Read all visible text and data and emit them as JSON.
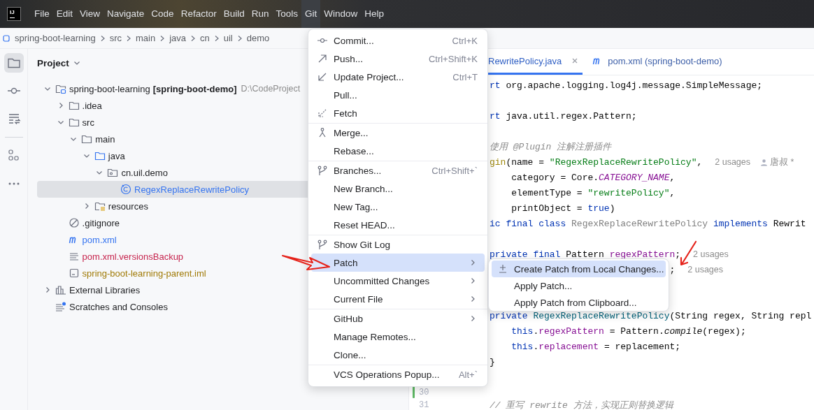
{
  "menubar": {
    "logo": "IJ",
    "items": [
      {
        "label": "File",
        "selected": false
      },
      {
        "label": "Edit",
        "selected": false
      },
      {
        "label": "View",
        "selected": false
      },
      {
        "label": "Navigate",
        "selected": false
      },
      {
        "label": "Code",
        "selected": false
      },
      {
        "label": "Refactor",
        "selected": false
      },
      {
        "label": "Build",
        "selected": false
      },
      {
        "label": "Run",
        "selected": false
      },
      {
        "label": "Tools",
        "selected": false
      },
      {
        "label": "Git",
        "selected": true
      },
      {
        "label": "Window",
        "selected": false
      },
      {
        "label": "Help",
        "selected": false
      }
    ]
  },
  "breadcrumb": [
    "spring-boot-learning",
    "src",
    "main",
    "java",
    "cn",
    "uil",
    "demo"
  ],
  "tool_strip": [
    {
      "kind": "project",
      "selected": true
    },
    {
      "kind": "commit",
      "selected": false
    },
    {
      "kind": "structure",
      "selected": false
    },
    {
      "kind": "plugins",
      "selected": false
    },
    {
      "kind": "more",
      "selected": false
    }
  ],
  "project": {
    "title": "Project",
    "tree": [
      {
        "label": "spring-boot-learning",
        "module": "[spring-boot-demo]",
        "path": "D:\\CodeProject",
        "kind": "module",
        "expanded": true,
        "selected": false,
        "children": [
          {
            "label": ".idea",
            "kind": "folder",
            "expanded": false,
            "selected": false
          },
          {
            "label": "src",
            "kind": "folder",
            "expanded": true,
            "selected": false,
            "children": [
              {
                "label": "main",
                "kind": "folder",
                "expanded": true,
                "selected": false,
                "children": [
                  {
                    "label": "java",
                    "kind": "source",
                    "expanded": true,
                    "selected": false,
                    "children": [
                      {
                        "label": "cn.uil.demo",
                        "kind": "package",
                        "expanded": true,
                        "selected": false,
                        "children": [
                          {
                            "label": "RegexReplaceRewritePolicy",
                            "kind": "class",
                            "selected": true,
                            "color": "#3574f0"
                          }
                        ]
                      }
                    ]
                  },
                  {
                    "label": "resources",
                    "kind": "resources",
                    "expanded": false,
                    "selected": false
                  }
                ]
              }
            ]
          },
          {
            "label": ".gitignore",
            "kind": "ignore",
            "selected": false
          },
          {
            "label": "pom.xml",
            "kind": "maven",
            "selected": false,
            "color": "#3574f0"
          },
          {
            "label": "pom.xml.versionsBackup",
            "kind": "text",
            "selected": false,
            "color": "#c7254e"
          },
          {
            "label": "spring-boot-learning-parent.iml",
            "kind": "iml",
            "selected": false,
            "color": "#a07a06"
          }
        ]
      },
      {
        "label": "External Libraries",
        "kind": "libraries",
        "expanded": false,
        "selected": false
      },
      {
        "label": "Scratches and Consoles",
        "kind": "scratches",
        "selected": false
      }
    ]
  },
  "editor": {
    "tabs": [
      {
        "label": "RewritePolicy.java",
        "kind": "cut",
        "selected": true
      },
      {
        "label": "pom.xml (spring-boot-demo)",
        "kind": "maven",
        "selected": false
      }
    ],
    "lines": [
      {
        "changed": false,
        "tokens": [
          {
            "kind": "keyword",
            "text": "rt"
          },
          {
            "kind": "plain",
            "text": " org.apache.logging.log4j.message.SimpleMessage;"
          }
        ]
      },
      {
        "changed": false
      },
      {
        "changed": false,
        "tokens": [
          {
            "kind": "keyword",
            "text": "rt"
          },
          {
            "kind": "plain",
            "text": " java.util.regex.Pattern;"
          }
        ]
      },
      {
        "changed": false
      },
      {
        "changed": false,
        "tokens": [
          {
            "kind": "comment",
            "text": "使用 @Plugin 注解注册插件"
          }
        ]
      },
      {
        "changed": false,
        "tokens": [
          {
            "kind": "annotation",
            "text": "gin"
          },
          {
            "kind": "plain",
            "text": "(name = "
          },
          {
            "kind": "string",
            "text": "\"RegexReplaceRewritePolicy\""
          },
          {
            "kind": "plain",
            "text": ","
          }
        ],
        "usages": "2 usages",
        "author": "唐叔 *"
      },
      {
        "changed": false,
        "tokens": [
          {
            "kind": "plain",
            "text": "    category = Core."
          },
          {
            "kind": "constant",
            "text": "CATEGORY_NAME"
          },
          {
            "kind": "plain",
            "text": ","
          }
        ]
      },
      {
        "changed": false,
        "tokens": [
          {
            "kind": "plain",
            "text": "    elementType = "
          },
          {
            "kind": "string",
            "text": "\"rewritePolicy\""
          },
          {
            "kind": "plain",
            "text": ","
          }
        ]
      },
      {
        "changed": false,
        "tokens": [
          {
            "kind": "plain",
            "text": "    printObject = "
          },
          {
            "kind": "keyword",
            "text": "true"
          },
          {
            "kind": "plain",
            "text": ")"
          }
        ]
      },
      {
        "changed": false,
        "tokens": [
          {
            "kind": "keyword",
            "text": "ic final class "
          },
          {
            "kind": "muted",
            "text": "RegexReplaceRewritePolicy "
          },
          {
            "kind": "keyword",
            "text": "implements"
          },
          {
            "kind": "plain",
            "text": " Rewrit"
          }
        ]
      },
      {
        "changed": false
      },
      {
        "changed": false,
        "tokens": [
          {
            "kind": "keyword",
            "text": "private final"
          },
          {
            "kind": "plain",
            "text": " Pattern "
          },
          {
            "kind": "field",
            "text": "regexPattern"
          },
          {
            "kind": "plain",
            "text": ";"
          }
        ],
        "usages": "2 usages"
      },
      {
        "changed": false,
        "tokens": [
          {
            "kind": "plain",
            "text": "                                 ;"
          }
        ],
        "usages": "2 usages"
      },
      {
        "changed": false
      },
      {
        "changed": false
      },
      {
        "changed": false,
        "tokens": [
          {
            "kind": "keyword",
            "text": "private "
          },
          {
            "kind": "method",
            "text": "RegexReplaceRewritePolicy"
          },
          {
            "kind": "plain",
            "text": "(String regex, String repl"
          }
        ]
      },
      {
        "changed": false,
        "tokens": [
          {
            "kind": "keyword",
            "text": "    this"
          },
          {
            "kind": "plain",
            "text": "."
          },
          {
            "kind": "field",
            "text": "regexPattern"
          },
          {
            "kind": "plain",
            "text": " = Pattern."
          },
          {
            "kind": "call",
            "text": "compile"
          },
          {
            "kind": "plain",
            "text": "(regex);"
          }
        ]
      },
      {
        "changed": false,
        "tokens": [
          {
            "kind": "keyword",
            "text": "    this"
          },
          {
            "kind": "plain",
            "text": "."
          },
          {
            "kind": "field",
            "text": "replacement"
          },
          {
            "kind": "plain",
            "text": " = replacement;"
          }
        ]
      },
      {
        "changed": false,
        "tokens": [
          {
            "kind": "plain",
            "text": "}"
          }
        ]
      },
      {
        "changed": false
      },
      {
        "changed": true,
        "number": "30"
      },
      {
        "changed": false,
        "number": "31",
        "tokens": [
          {
            "kind": "comment",
            "text": "// 重写 rewrite 方法，实现正则替换逻辑"
          }
        ]
      }
    ]
  },
  "git_menu": {
    "groups": [
      {
        "items": [
          {
            "label": "Commit...",
            "shortcut": "Ctrl+K",
            "kind": "commit",
            "submenu": false,
            "selected": false
          },
          {
            "label": "Push...",
            "shortcut": "Ctrl+Shift+K",
            "kind": "push",
            "submenu": false,
            "selected": false
          },
          {
            "label": "Update Project...",
            "shortcut": "Ctrl+T",
            "kind": "update",
            "submenu": false,
            "selected": false
          },
          {
            "label": "Pull...",
            "kind": "plain",
            "submenu": false,
            "selected": false
          },
          {
            "label": "Fetch",
            "kind": "fetch",
            "submenu": false,
            "selected": false
          }
        ]
      },
      {
        "items": [
          {
            "label": "Merge...",
            "kind": "merge",
            "submenu": false,
            "selected": false
          },
          {
            "label": "Rebase...",
            "kind": "plain",
            "submenu": false,
            "selected": false
          }
        ]
      },
      {
        "items": [
          {
            "label": "Branches...",
            "shortcut": "Ctrl+Shift+`",
            "kind": "branch",
            "submenu": false,
            "selected": false
          },
          {
            "label": "New Branch...",
            "kind": "plain",
            "submenu": false,
            "selected": false
          },
          {
            "label": "New Tag...",
            "kind": "plain",
            "submenu": false,
            "selected": false
          },
          {
            "label": "Reset HEAD...",
            "kind": "plain",
            "submenu": false,
            "selected": false
          }
        ]
      },
      {
        "items": [
          {
            "label": "Show Git Log",
            "kind": "branch",
            "submenu": false,
            "selected": false
          },
          {
            "label": "Patch",
            "kind": "plain",
            "submenu": true,
            "selected": true
          },
          {
            "label": "Uncommitted Changes",
            "kind": "plain",
            "submenu": true,
            "selected": false
          },
          {
            "label": "Current File",
            "kind": "plain",
            "submenu": true,
            "selected": false
          }
        ]
      },
      {
        "items": [
          {
            "label": "GitHub",
            "kind": "plain",
            "submenu": true,
            "selected": false
          },
          {
            "label": "Manage Remotes...",
            "kind": "plain",
            "submenu": false,
            "selected": false
          },
          {
            "label": "Clone...",
            "kind": "plain",
            "submenu": false,
            "selected": false
          }
        ]
      },
      {
        "items": [
          {
            "label": "VCS Operations Popup...",
            "shortcut": "Alt+`",
            "kind": "plain",
            "submenu": false,
            "selected": false
          }
        ]
      }
    ]
  },
  "patch_submenu": {
    "groups": [
      {
        "items": [
          {
            "label": "Create Patch from Local Changes...",
            "kind": "diff",
            "submenu": false,
            "selected": true
          },
          {
            "label": "Apply Patch...",
            "kind": "plain",
            "submenu": false,
            "selected": false
          },
          {
            "label": "Apply Patch from Clipboard...",
            "kind": "plain",
            "submenu": false,
            "selected": false
          }
        ]
      }
    ]
  }
}
